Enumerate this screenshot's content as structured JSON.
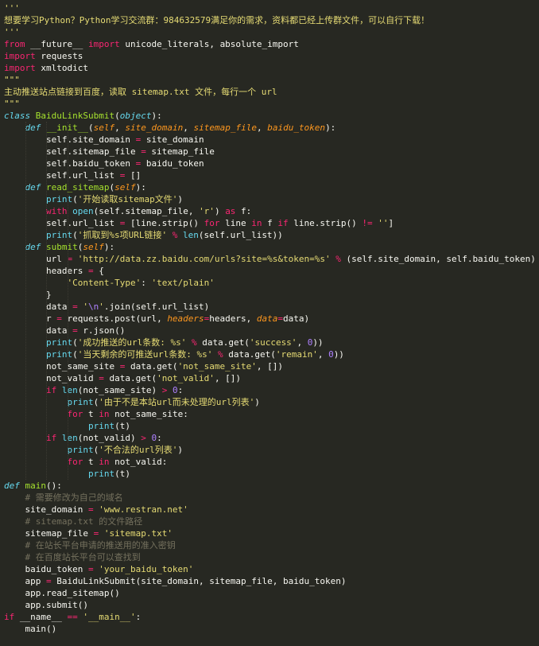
{
  "editor": {
    "lines": [
      [
        [
          "str",
          "'''"
        ]
      ],
      [
        [
          "str",
          "想要学习Python？Python学习交流群：984632579满足你的需求，资料都已经上传群文件，可以自行下载！"
        ]
      ],
      [
        [
          "str",
          "'''"
        ]
      ],
      [
        [
          "kw",
          "from"
        ],
        [
          "t",
          " __future__ "
        ],
        [
          "kw",
          "import"
        ],
        [
          "t",
          " unicode_literals, absolute_import"
        ]
      ],
      [
        [
          "kw",
          "import"
        ],
        [
          "t",
          " requests"
        ]
      ],
      [
        [
          "kw",
          "import"
        ],
        [
          "t",
          " xmltodict"
        ]
      ],
      [
        [
          "str",
          "\"\"\""
        ]
      ],
      [
        [
          "str",
          "主动推送站点链接到百度，读取 sitemap.txt 文件，每行一个 url"
        ]
      ],
      [
        [
          "str",
          "\"\"\""
        ]
      ],
      [
        [
          "cls",
          "class"
        ],
        [
          "t",
          " "
        ],
        [
          "fn",
          "BaiduLinkSubmit"
        ],
        [
          "t",
          "("
        ],
        [
          "cls",
          "object"
        ],
        [
          "t",
          "):"
        ]
      ],
      [
        [
          "t",
          "    "
        ],
        [
          "cls",
          "def"
        ],
        [
          "t",
          " "
        ],
        [
          "fn",
          "__init__"
        ],
        [
          "t",
          "("
        ],
        [
          "par",
          "self"
        ],
        [
          "t",
          ", "
        ],
        [
          "par",
          "site_domain"
        ],
        [
          "t",
          ", "
        ],
        [
          "par",
          "sitemap_file"
        ],
        [
          "t",
          ", "
        ],
        [
          "par",
          "baidu_token"
        ],
        [
          "t",
          "):"
        ]
      ],
      [
        [
          "t",
          "        self.site_domain "
        ],
        [
          "op",
          "="
        ],
        [
          "t",
          " site_domain"
        ]
      ],
      [
        [
          "t",
          "        self.sitemap_file "
        ],
        [
          "op",
          "="
        ],
        [
          "t",
          " sitemap_file"
        ]
      ],
      [
        [
          "t",
          "        self.baidu_token "
        ],
        [
          "op",
          "="
        ],
        [
          "t",
          " baidu_token"
        ]
      ],
      [
        [
          "t",
          "        self.url_list "
        ],
        [
          "op",
          "="
        ],
        [
          "t",
          " []"
        ]
      ],
      [
        [
          "t",
          "    "
        ],
        [
          "cls",
          "def"
        ],
        [
          "t",
          " "
        ],
        [
          "fn",
          "read_sitemap"
        ],
        [
          "t",
          "("
        ],
        [
          "par",
          "self"
        ],
        [
          "t",
          "):"
        ]
      ],
      [
        [
          "t",
          "        "
        ],
        [
          "bi",
          "print"
        ],
        [
          "t",
          "("
        ],
        [
          "str",
          "'开始读取sitemap文件'"
        ],
        [
          "t",
          ")"
        ]
      ],
      [
        [
          "t",
          "        "
        ],
        [
          "kw",
          "with"
        ],
        [
          "t",
          " "
        ],
        [
          "bi",
          "open"
        ],
        [
          "t",
          "(self.sitemap_file, "
        ],
        [
          "str",
          "'r'"
        ],
        [
          "t",
          ") "
        ],
        [
          "kw",
          "as"
        ],
        [
          "t",
          " f:"
        ]
      ],
      [
        [
          "t",
          "        self.url_list "
        ],
        [
          "op",
          "="
        ],
        [
          "t",
          " [line.strip() "
        ],
        [
          "kw",
          "for"
        ],
        [
          "t",
          " line "
        ],
        [
          "kw",
          "in"
        ],
        [
          "t",
          " f "
        ],
        [
          "kw",
          "if"
        ],
        [
          "t",
          " line.strip() "
        ],
        [
          "op",
          "!="
        ],
        [
          "t",
          " "
        ],
        [
          "str",
          "''"
        ],
        [
          "t",
          "]"
        ]
      ],
      [
        [
          "t",
          "        "
        ],
        [
          "bi",
          "print"
        ],
        [
          "t",
          "("
        ],
        [
          "str",
          "'抓取到%s项URL链接'"
        ],
        [
          "t",
          " "
        ],
        [
          "op",
          "%"
        ],
        [
          "t",
          " "
        ],
        [
          "bi",
          "len"
        ],
        [
          "t",
          "(self.url_list))"
        ]
      ],
      [
        [
          "t",
          "    "
        ],
        [
          "cls",
          "def"
        ],
        [
          "t",
          " "
        ],
        [
          "fn",
          "submit"
        ],
        [
          "t",
          "("
        ],
        [
          "par",
          "self"
        ],
        [
          "t",
          "):"
        ]
      ],
      [
        [
          "t",
          "        url "
        ],
        [
          "op",
          "="
        ],
        [
          "t",
          " "
        ],
        [
          "str",
          "'http://data.zz.baidu.com/urls?site=%s&token=%s'"
        ],
        [
          "t",
          " "
        ],
        [
          "op",
          "%"
        ],
        [
          "t",
          " (self.site_domain, self.baidu_token)"
        ]
      ],
      [
        [
          "t",
          "        headers "
        ],
        [
          "op",
          "="
        ],
        [
          "t",
          " {"
        ]
      ],
      [
        [
          "t",
          "            "
        ],
        [
          "str",
          "'Content-Type'"
        ],
        [
          "t",
          ": "
        ],
        [
          "str",
          "'text/plain'"
        ]
      ],
      [
        [
          "t",
          "        }"
        ]
      ],
      [
        [
          "t",
          "        data "
        ],
        [
          "op",
          "="
        ],
        [
          "t",
          " "
        ],
        [
          "str",
          "'"
        ],
        [
          "num",
          "\\n"
        ],
        [
          "str",
          "'"
        ],
        [
          "t",
          ".join(self.url_list)"
        ]
      ],
      [
        [
          "t",
          "        r "
        ],
        [
          "op",
          "="
        ],
        [
          "t",
          " requests.post(url, "
        ],
        [
          "par",
          "headers"
        ],
        [
          "op",
          "="
        ],
        [
          "t",
          "headers, "
        ],
        [
          "par",
          "data"
        ],
        [
          "op",
          "="
        ],
        [
          "t",
          "data)"
        ]
      ],
      [
        [
          "t",
          "        data "
        ],
        [
          "op",
          "="
        ],
        [
          "t",
          " r.json()"
        ]
      ],
      [
        [
          "t",
          "        "
        ],
        [
          "bi",
          "print"
        ],
        [
          "t",
          "("
        ],
        [
          "str",
          "'成功推送的url条数: %s'"
        ],
        [
          "t",
          " "
        ],
        [
          "op",
          "%"
        ],
        [
          "t",
          " data.get("
        ],
        [
          "str",
          "'success'"
        ],
        [
          "t",
          ", "
        ],
        [
          "num",
          "0"
        ],
        [
          "t",
          "))"
        ]
      ],
      [
        [
          "t",
          "        "
        ],
        [
          "bi",
          "print"
        ],
        [
          "t",
          "("
        ],
        [
          "str",
          "'当天剩余的可推送url条数: %s'"
        ],
        [
          "t",
          " "
        ],
        [
          "op",
          "%"
        ],
        [
          "t",
          " data.get("
        ],
        [
          "str",
          "'remain'"
        ],
        [
          "t",
          ", "
        ],
        [
          "num",
          "0"
        ],
        [
          "t",
          "))"
        ]
      ],
      [
        [
          "t",
          "        not_same_site "
        ],
        [
          "op",
          "="
        ],
        [
          "t",
          " data.get("
        ],
        [
          "str",
          "'not_same_site'"
        ],
        [
          "t",
          ", [])"
        ]
      ],
      [
        [
          "t",
          "        not_valid "
        ],
        [
          "op",
          "="
        ],
        [
          "t",
          " data.get("
        ],
        [
          "str",
          "'not_valid'"
        ],
        [
          "t",
          ", [])"
        ]
      ],
      [
        [
          "t",
          "        "
        ],
        [
          "kw",
          "if"
        ],
        [
          "t",
          " "
        ],
        [
          "bi",
          "len"
        ],
        [
          "t",
          "(not_same_site) "
        ],
        [
          "op",
          ">"
        ],
        [
          "t",
          " "
        ],
        [
          "num",
          "0"
        ],
        [
          "t",
          ":"
        ]
      ],
      [
        [
          "t",
          "            "
        ],
        [
          "bi",
          "print"
        ],
        [
          "t",
          "("
        ],
        [
          "str",
          "'由于不是本站url而未处理的url列表'"
        ],
        [
          "t",
          ")"
        ]
      ],
      [
        [
          "t",
          "            "
        ],
        [
          "kw",
          "for"
        ],
        [
          "t",
          " t "
        ],
        [
          "kw",
          "in"
        ],
        [
          "t",
          " not_same_site:"
        ]
      ],
      [
        [
          "t",
          "                "
        ],
        [
          "bi",
          "print"
        ],
        [
          "t",
          "(t)"
        ]
      ],
      [
        [
          "t",
          "        "
        ],
        [
          "kw",
          "if"
        ],
        [
          "t",
          " "
        ],
        [
          "bi",
          "len"
        ],
        [
          "t",
          "(not_valid) "
        ],
        [
          "op",
          ">"
        ],
        [
          "t",
          " "
        ],
        [
          "num",
          "0"
        ],
        [
          "t",
          ":"
        ]
      ],
      [
        [
          "t",
          "            "
        ],
        [
          "bi",
          "print"
        ],
        [
          "t",
          "("
        ],
        [
          "str",
          "'不合法的url列表'"
        ],
        [
          "t",
          ")"
        ]
      ],
      [
        [
          "t",
          "            "
        ],
        [
          "kw",
          "for"
        ],
        [
          "t",
          " t "
        ],
        [
          "kw",
          "in"
        ],
        [
          "t",
          " not_valid:"
        ]
      ],
      [
        [
          "t",
          "                "
        ],
        [
          "bi",
          "print"
        ],
        [
          "t",
          "(t)"
        ]
      ],
      [
        [
          "cls",
          "def"
        ],
        [
          "t",
          " "
        ],
        [
          "fn",
          "main"
        ],
        [
          "t",
          "():"
        ]
      ],
      [
        [
          "t",
          "    "
        ],
        [
          "cm",
          "# 需要修改为自己的域名"
        ]
      ],
      [
        [
          "t",
          "    site_domain "
        ],
        [
          "op",
          "="
        ],
        [
          "t",
          " "
        ],
        [
          "str",
          "'www.restran.net'"
        ]
      ],
      [
        [
          "t",
          "    "
        ],
        [
          "cm",
          "# sitemap.txt 的文件路径"
        ]
      ],
      [
        [
          "t",
          "    sitemap_file "
        ],
        [
          "op",
          "="
        ],
        [
          "t",
          " "
        ],
        [
          "str",
          "'sitemap.txt'"
        ]
      ],
      [
        [
          "t",
          "    "
        ],
        [
          "cm",
          "# 在站长平台申请的推送用的准入密钥"
        ]
      ],
      [
        [
          "t",
          "    "
        ],
        [
          "cm",
          "# 在百度站长平台可以查找到"
        ]
      ],
      [
        [
          "t",
          "    baidu_token "
        ],
        [
          "op",
          "="
        ],
        [
          "t",
          " "
        ],
        [
          "str",
          "'your_baidu_token'"
        ]
      ],
      [
        [
          "t",
          "    app "
        ],
        [
          "op",
          "="
        ],
        [
          "t",
          " BaiduLinkSubmit(site_domain, sitemap_file, baidu_token)"
        ]
      ],
      [
        [
          "t",
          "    app.read_sitemap()"
        ]
      ],
      [
        [
          "t",
          "    app.submit()"
        ]
      ],
      [
        [
          "kw",
          "if"
        ],
        [
          "t",
          " __name__ "
        ],
        [
          "op",
          "=="
        ],
        [
          "t",
          " "
        ],
        [
          "str",
          "'__main__'"
        ],
        [
          "t",
          ":"
        ]
      ],
      [
        [
          "t",
          "    main()"
        ]
      ]
    ]
  }
}
